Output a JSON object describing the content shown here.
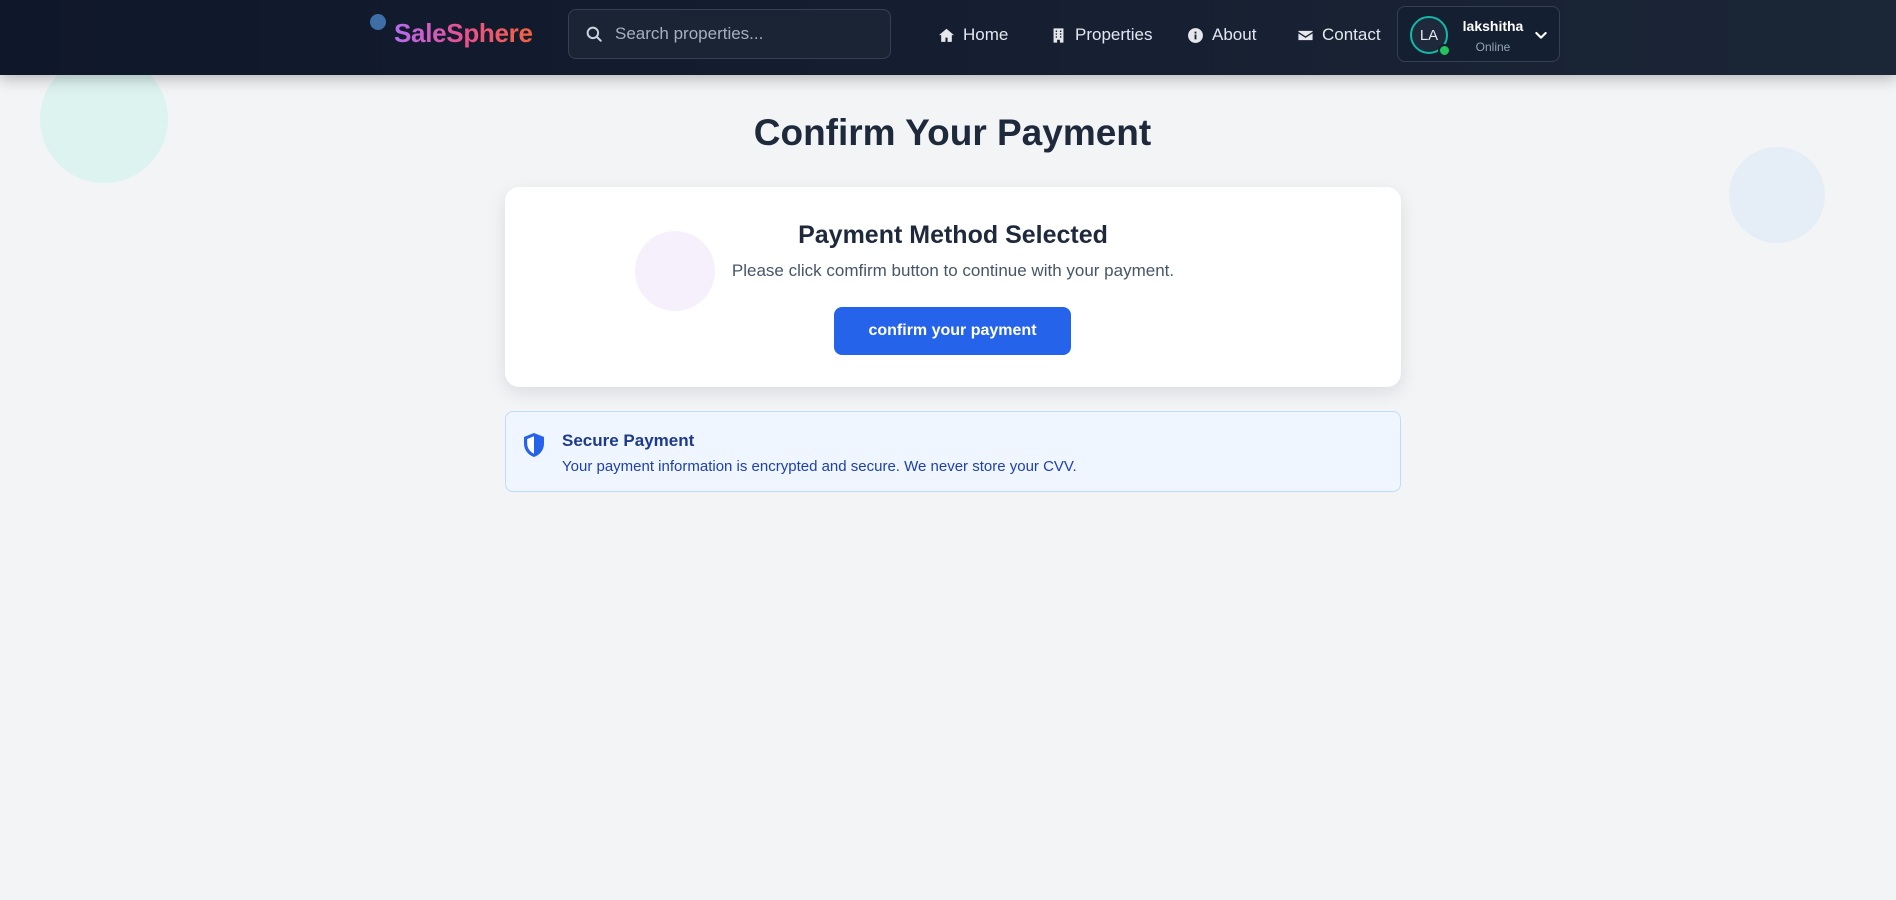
{
  "brand": {
    "name": "SaleSphere"
  },
  "search": {
    "placeholder": "Search properties..."
  },
  "nav": {
    "home": "Home",
    "properties": "Properties",
    "about": "About",
    "contact": "Contact"
  },
  "user": {
    "initials": "LA",
    "name": "lakshitha",
    "status": "Online"
  },
  "page": {
    "title": "Confirm Your Payment"
  },
  "card": {
    "title": "Payment Method Selected",
    "text": "Please click comfirm button to continue with your payment.",
    "button": "confirm your payment"
  },
  "secure": {
    "title": "Secure Payment",
    "text": "Your payment information is encrypted and secure. We never store your CVV."
  },
  "colors": {
    "navbar": "#0f172a",
    "accent": "#2563eb",
    "online": "#22c55e",
    "avatar_ring": "#14b8a6",
    "info_bg": "#eff6ff"
  },
  "icons": [
    "search-icon",
    "home-icon",
    "building-icon",
    "info-icon",
    "envelope-icon",
    "chevron-down-icon",
    "shield-icon"
  ]
}
